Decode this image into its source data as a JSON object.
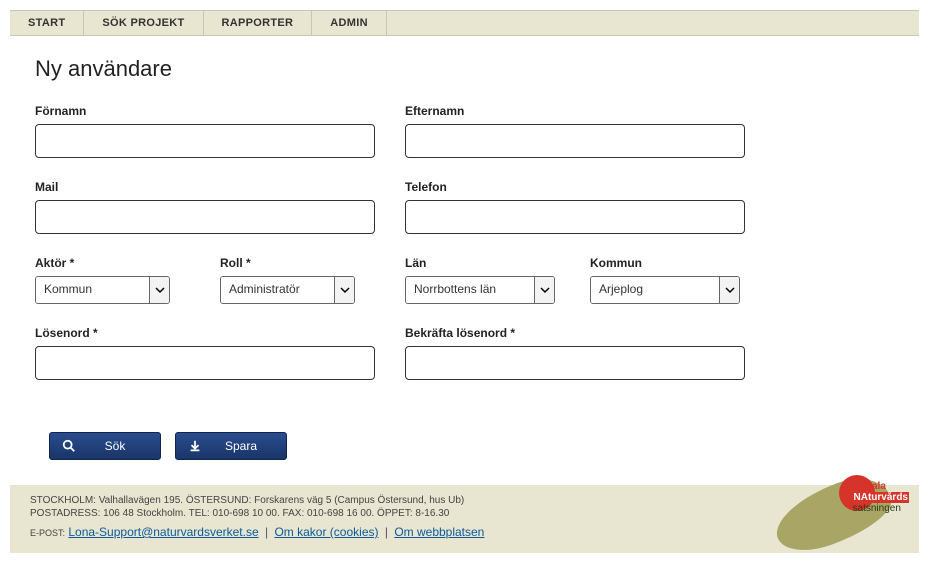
{
  "nav": {
    "items": [
      {
        "label": "START"
      },
      {
        "label": "SÖK PROJEKT"
      },
      {
        "label": "RAPPORTER"
      },
      {
        "label": "ADMIN"
      }
    ]
  },
  "page": {
    "title": "Ny användare"
  },
  "form": {
    "fornamn": {
      "label": "Förnamn",
      "value": ""
    },
    "efternamn": {
      "label": "Efternamn",
      "value": ""
    },
    "mail": {
      "label": "Mail",
      "value": ""
    },
    "telefon": {
      "label": "Telefon",
      "value": ""
    },
    "aktor": {
      "label": "Aktör *",
      "value": "Kommun"
    },
    "roll": {
      "label": "Roll *",
      "value": "Administratör"
    },
    "lan": {
      "label": "Län",
      "value": "Norrbottens län"
    },
    "kommun": {
      "label": "Kommun",
      "value": "Arjeplog"
    },
    "losenord": {
      "label": "Lösenord *",
      "value": ""
    },
    "bekrafta": {
      "label": "Bekräfta lösenord *",
      "value": ""
    }
  },
  "buttons": {
    "sok": "Sök",
    "spara": "Spara"
  },
  "footer": {
    "line1": "STOCKHOLM: Valhallavägen 195. ÖSTERSUND: Forskarens väg 5 (Campus Östersund, hus Ub)",
    "line2": "POSTADRESS: 106 48 Stockholm. TEL: 010-698 10 00. FAX: 010-698 16 00. ÖPPET: 8-16.30",
    "epost_label": "E-POST:",
    "email": "Lona-Support@naturvardsverket.se",
    "link_kakor": "Om kakor (cookies)",
    "link_webb": "Om webbplatsen",
    "logo": {
      "l1": "LOkala",
      "l2": "NAturvårds",
      "l3": "satsningen"
    }
  }
}
